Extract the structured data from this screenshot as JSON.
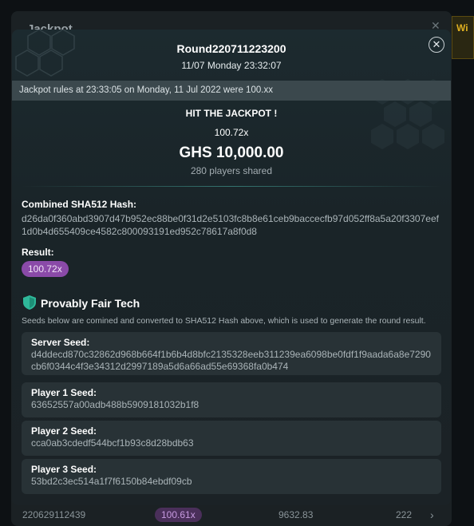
{
  "background": {
    "panel_title": "Jackpot",
    "close_glyph": "✕",
    "right_strip_text": "Wi",
    "row": {
      "round": "220629112439",
      "multiplier": "100.61x",
      "amount": "9632.83",
      "players": "222",
      "chevron": "›"
    }
  },
  "modal": {
    "round_title": "Round220711223200",
    "round_date": "11/07 Monday 23:32:07",
    "close_glyph": "✕",
    "rules_text": "Jackpot rules at 23:33:05 on Monday, 11 Jul 2022 were 100.xx",
    "hit_text": "HIT THE JACKPOT !",
    "multiplier": "100.72x",
    "amount": "GHS 10,000.00",
    "players_shared": "280 players shared",
    "hash_label": "Combined SHA512 Hash:",
    "hash_value": "d26da0f360abd3907d47b952ec88be0f31d2e5103fc8b8e61ceb9baccecfb97d052ff8a5a20f3307eef1d0b4d655409ce4582c800093191ed952c78617a8f0d8",
    "result_label": "Result:",
    "result_value": "100.72x",
    "pft_title": "Provably Fair Tech",
    "pft_desc": "Seeds below are comined and converted to SHA512 Hash above, which is used to generate the round result.",
    "seeds": [
      {
        "label": "Server Seed:",
        "value": "d4ddecd870c32862d968b664f1b6b4d8bfc2135328eeb311239ea6098be0fdf1f9aada6a8e7290cb6f0344c4f3e34312d2997189a5d6a66ad55e69368fa0b474"
      },
      {
        "label": "Player 1 Seed:",
        "value": "63652557a00adb488b5909181032b1f8"
      },
      {
        "label": "Player 2 Seed:",
        "value": "cca0ab3cdedf544bcf1b93c8d28bdb63"
      },
      {
        "label": "Player 3 Seed:",
        "value": "53bd2c3ec514a1f7f6150b84ebdf09cb"
      }
    ],
    "colors": {
      "result_badge": "#8a4aa8",
      "shield": "#2fb89a",
      "rules_bar": "#3b484d"
    },
    "icons": {
      "shield": "shield-icon",
      "close": "close-icon"
    }
  }
}
